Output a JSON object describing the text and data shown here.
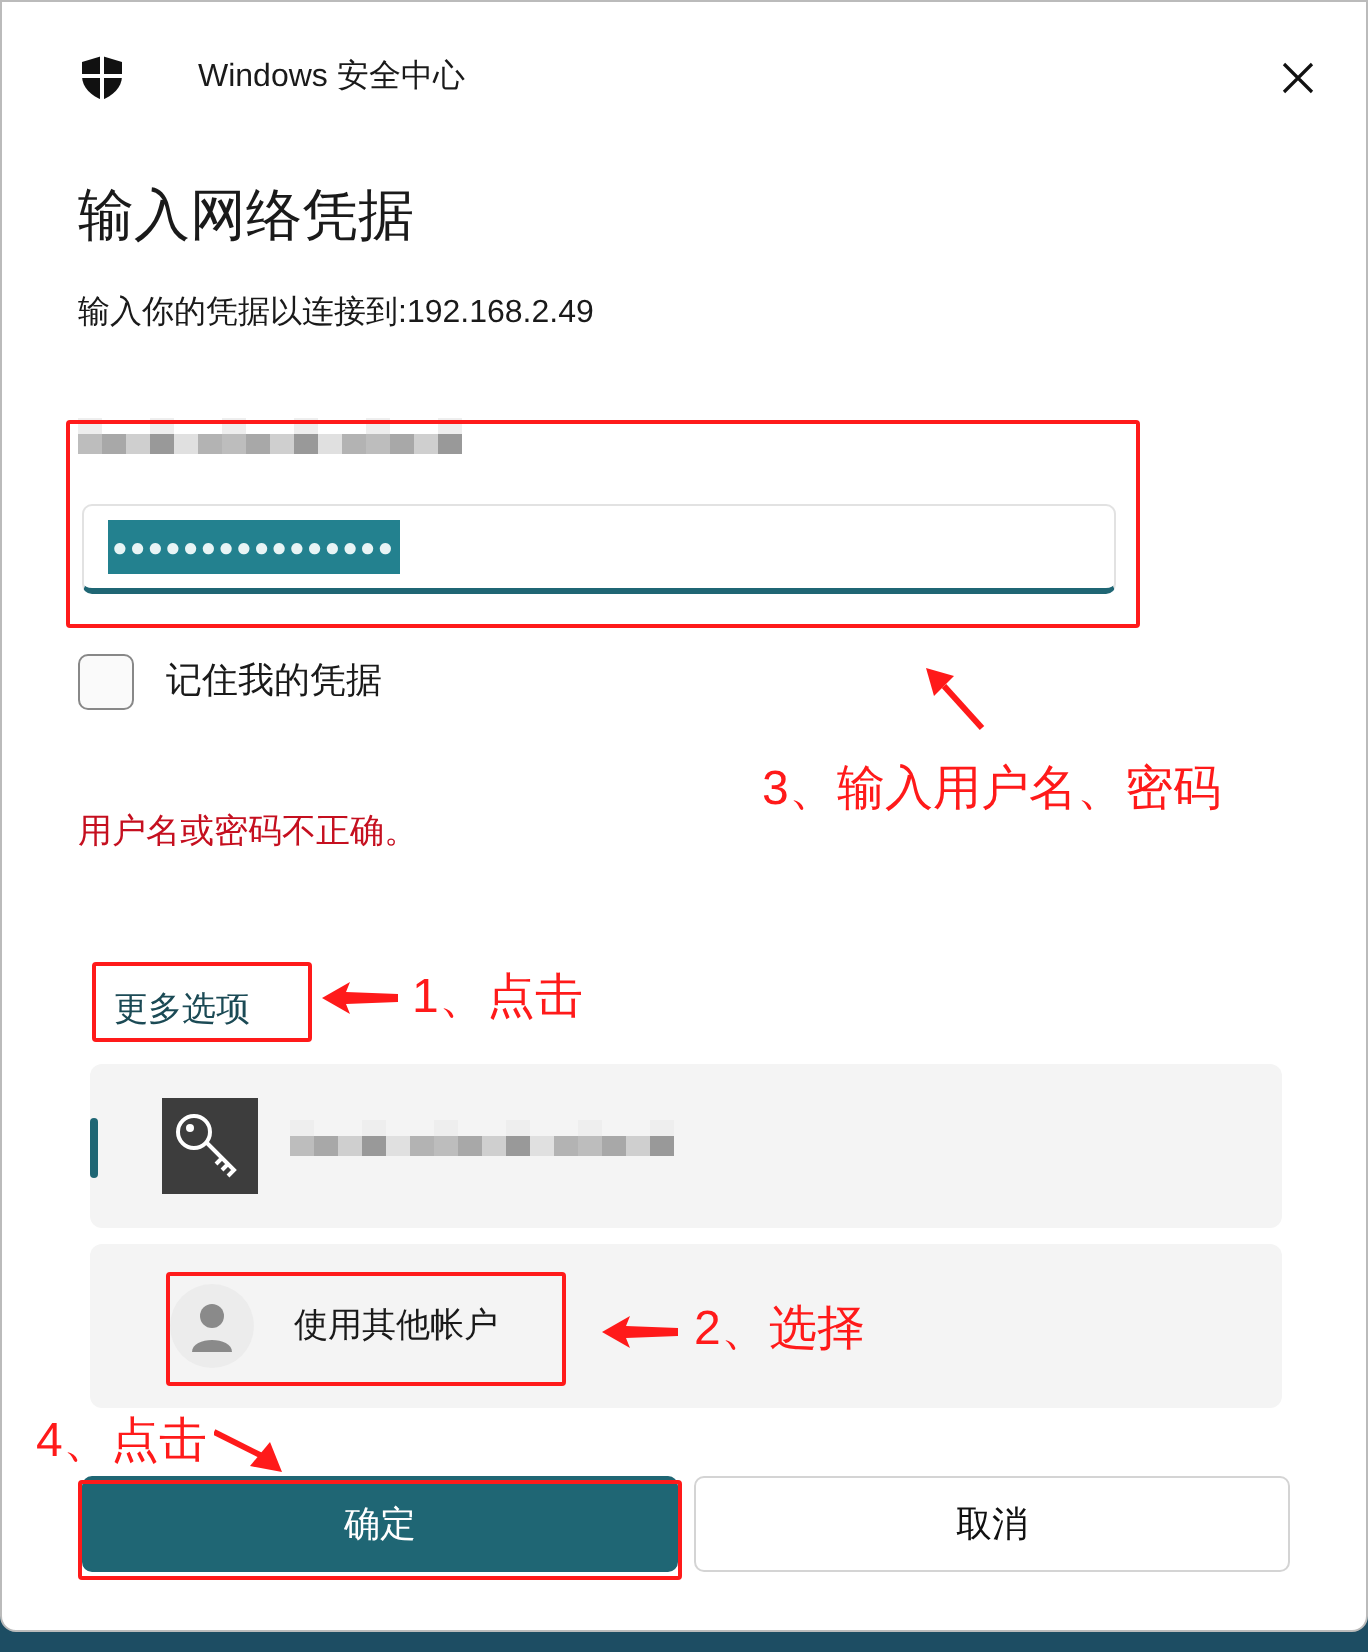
{
  "window": {
    "title": "Windows 安全中心"
  },
  "heading": "输入网络凭据",
  "subtitle": "输入你的凭据以连接到:192.168.2.49",
  "password": {
    "value": "●●●●●●●●●●●●●●●●",
    "highlighted": true
  },
  "remember": {
    "label": "记住我的凭据",
    "checked": false
  },
  "error": "用户名或密码不正确。",
  "more_options": "更多选项",
  "accounts": [
    {
      "kind": "key",
      "selected": true
    },
    {
      "kind": "other",
      "label": "使用其他帐户",
      "selected": false
    }
  ],
  "buttons": [
    {
      "label": "确定",
      "primary": true
    },
    {
      "label": "取消",
      "primary": false
    }
  ],
  "annotations": [
    {
      "text": "3、输入用户名、密码"
    },
    {
      "text": "1、点击"
    },
    {
      "text": "2、选择"
    },
    {
      "text": "4、点击"
    }
  ]
}
